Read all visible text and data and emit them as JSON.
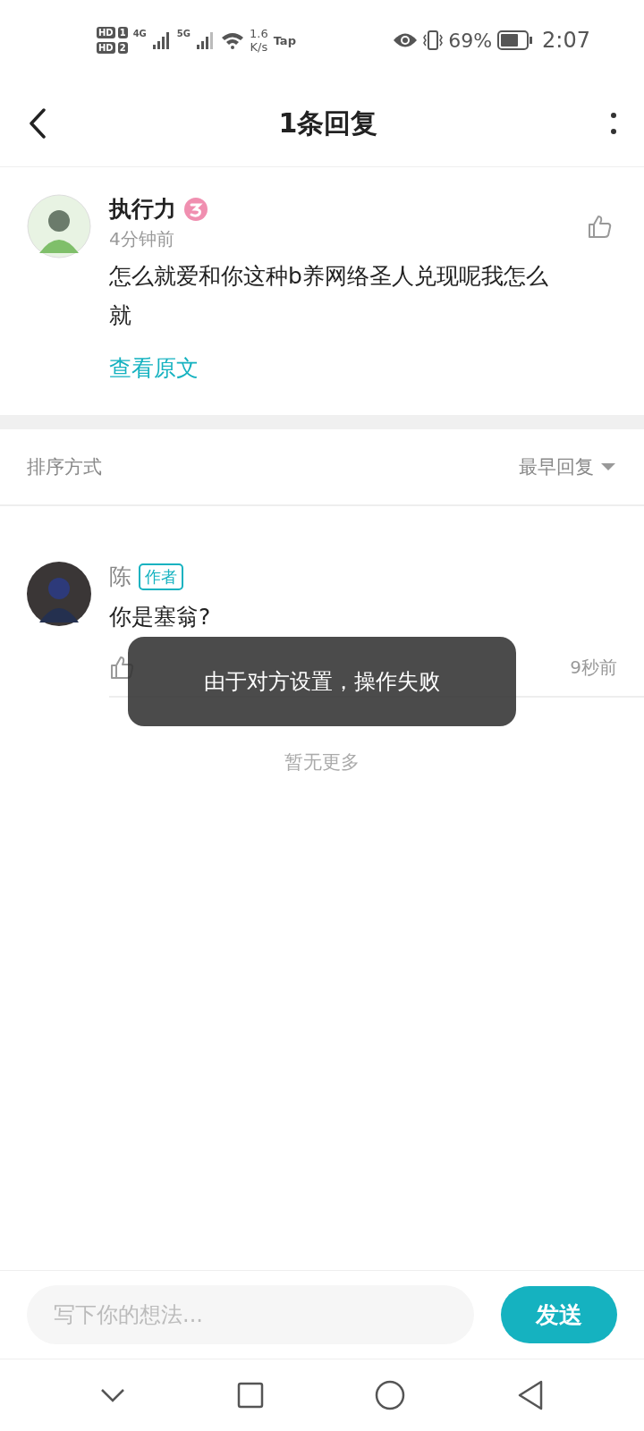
{
  "status_bar": {
    "sims": [
      {
        "label": "HD",
        "slot": "1"
      },
      {
        "label": "HD",
        "slot": "2"
      }
    ],
    "networks": [
      "4G",
      "5G"
    ],
    "speed_value": "1.6",
    "speed_unit": "K/s",
    "app": "Tap",
    "battery": "69%",
    "time": "2:07"
  },
  "header": {
    "title": "1条回复"
  },
  "comment": {
    "author": "执行力",
    "time": "4分钟前",
    "text": "怎么就爱和你这种b养网络圣人兑现呢我怎么就",
    "view_original": "查看原文"
  },
  "sort": {
    "label": "排序方式",
    "value": "最早回复"
  },
  "replies": [
    {
      "author": "陈",
      "badge": "作者",
      "text": "你是塞翁?",
      "time": "9秒前"
    }
  ],
  "end_note": "暂无更多",
  "toast": "由于对方设置，操作失败",
  "composer": {
    "placeholder": "写下你的想法...",
    "send": "发送"
  }
}
